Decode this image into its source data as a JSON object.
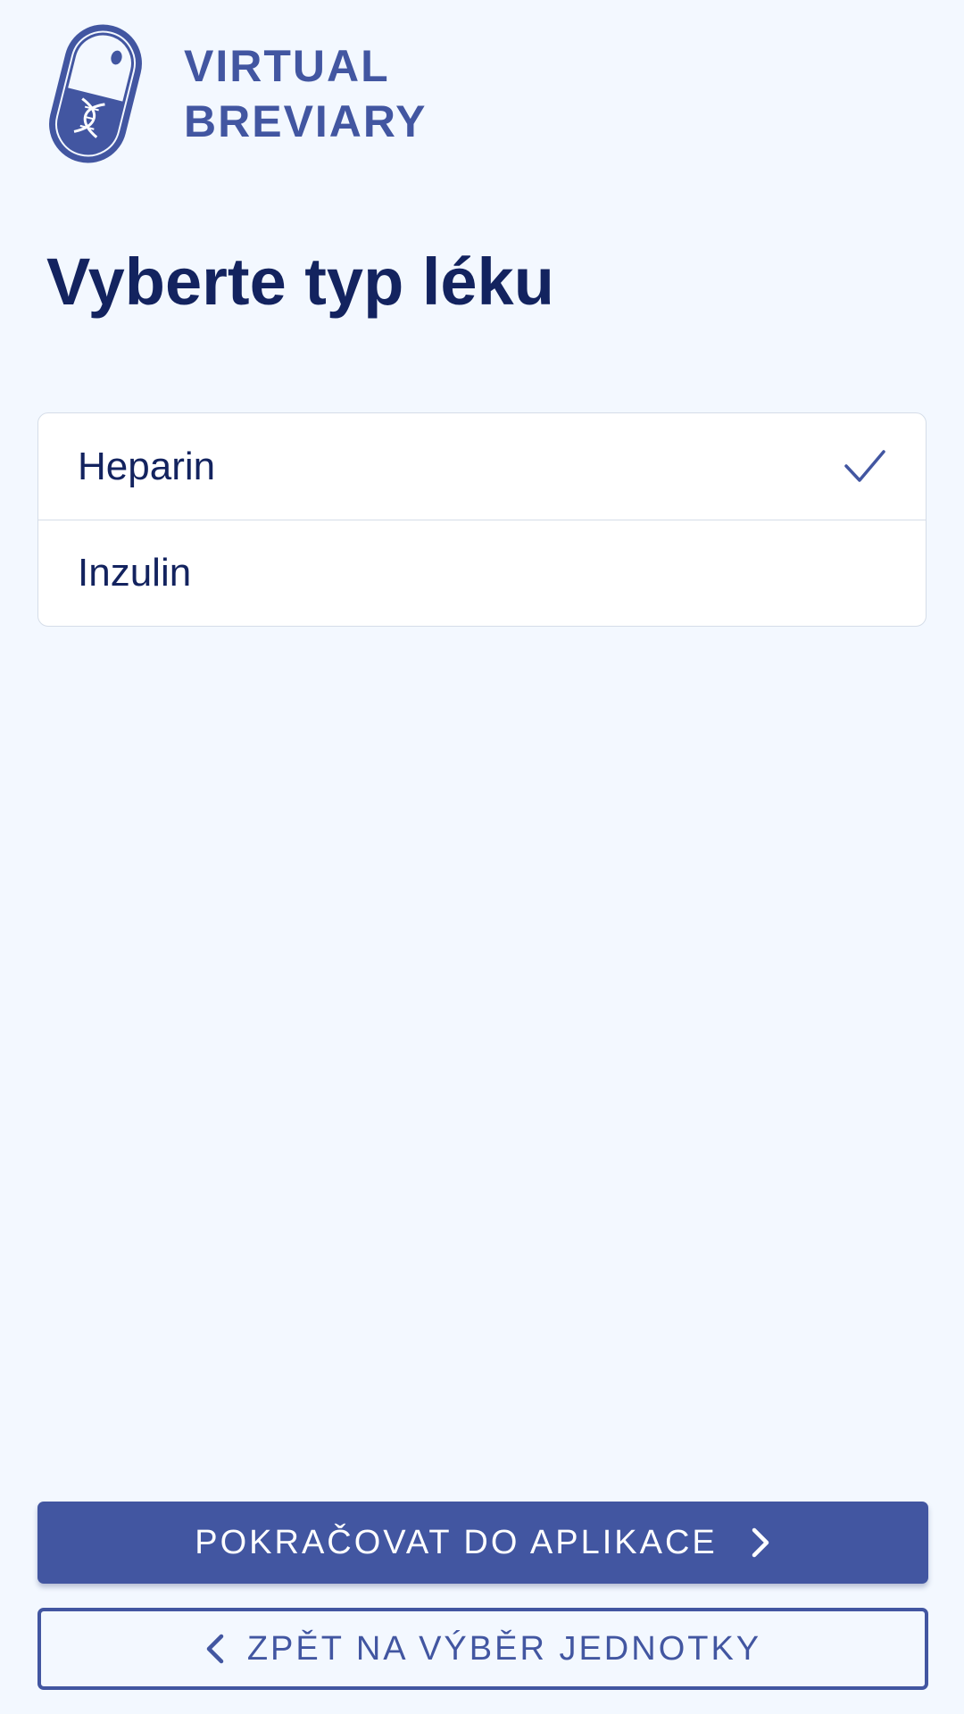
{
  "brand": {
    "name_line1": "VIRTUAL",
    "name_line2": "BREVIARY",
    "logo_icon": "capsule-dna-icon",
    "color": "#4256a1"
  },
  "page": {
    "title": "Vyberte typ léku"
  },
  "options": [
    {
      "label": "Heparin",
      "selected": true
    },
    {
      "label": "Inzulin",
      "selected": false
    }
  ],
  "actions": {
    "continue_label": "POKRAČOVAT DO APLIKACE",
    "back_label": "ZPĚT NA VÝBĚR JEDNOTKY"
  },
  "icons": {
    "selected_indicator": "check-icon",
    "continue": "chevron-right-icon",
    "back": "chevron-left-icon"
  },
  "colors": {
    "background": "#f3f8ff",
    "primary": "#4256a1",
    "title": "#13235f"
  }
}
